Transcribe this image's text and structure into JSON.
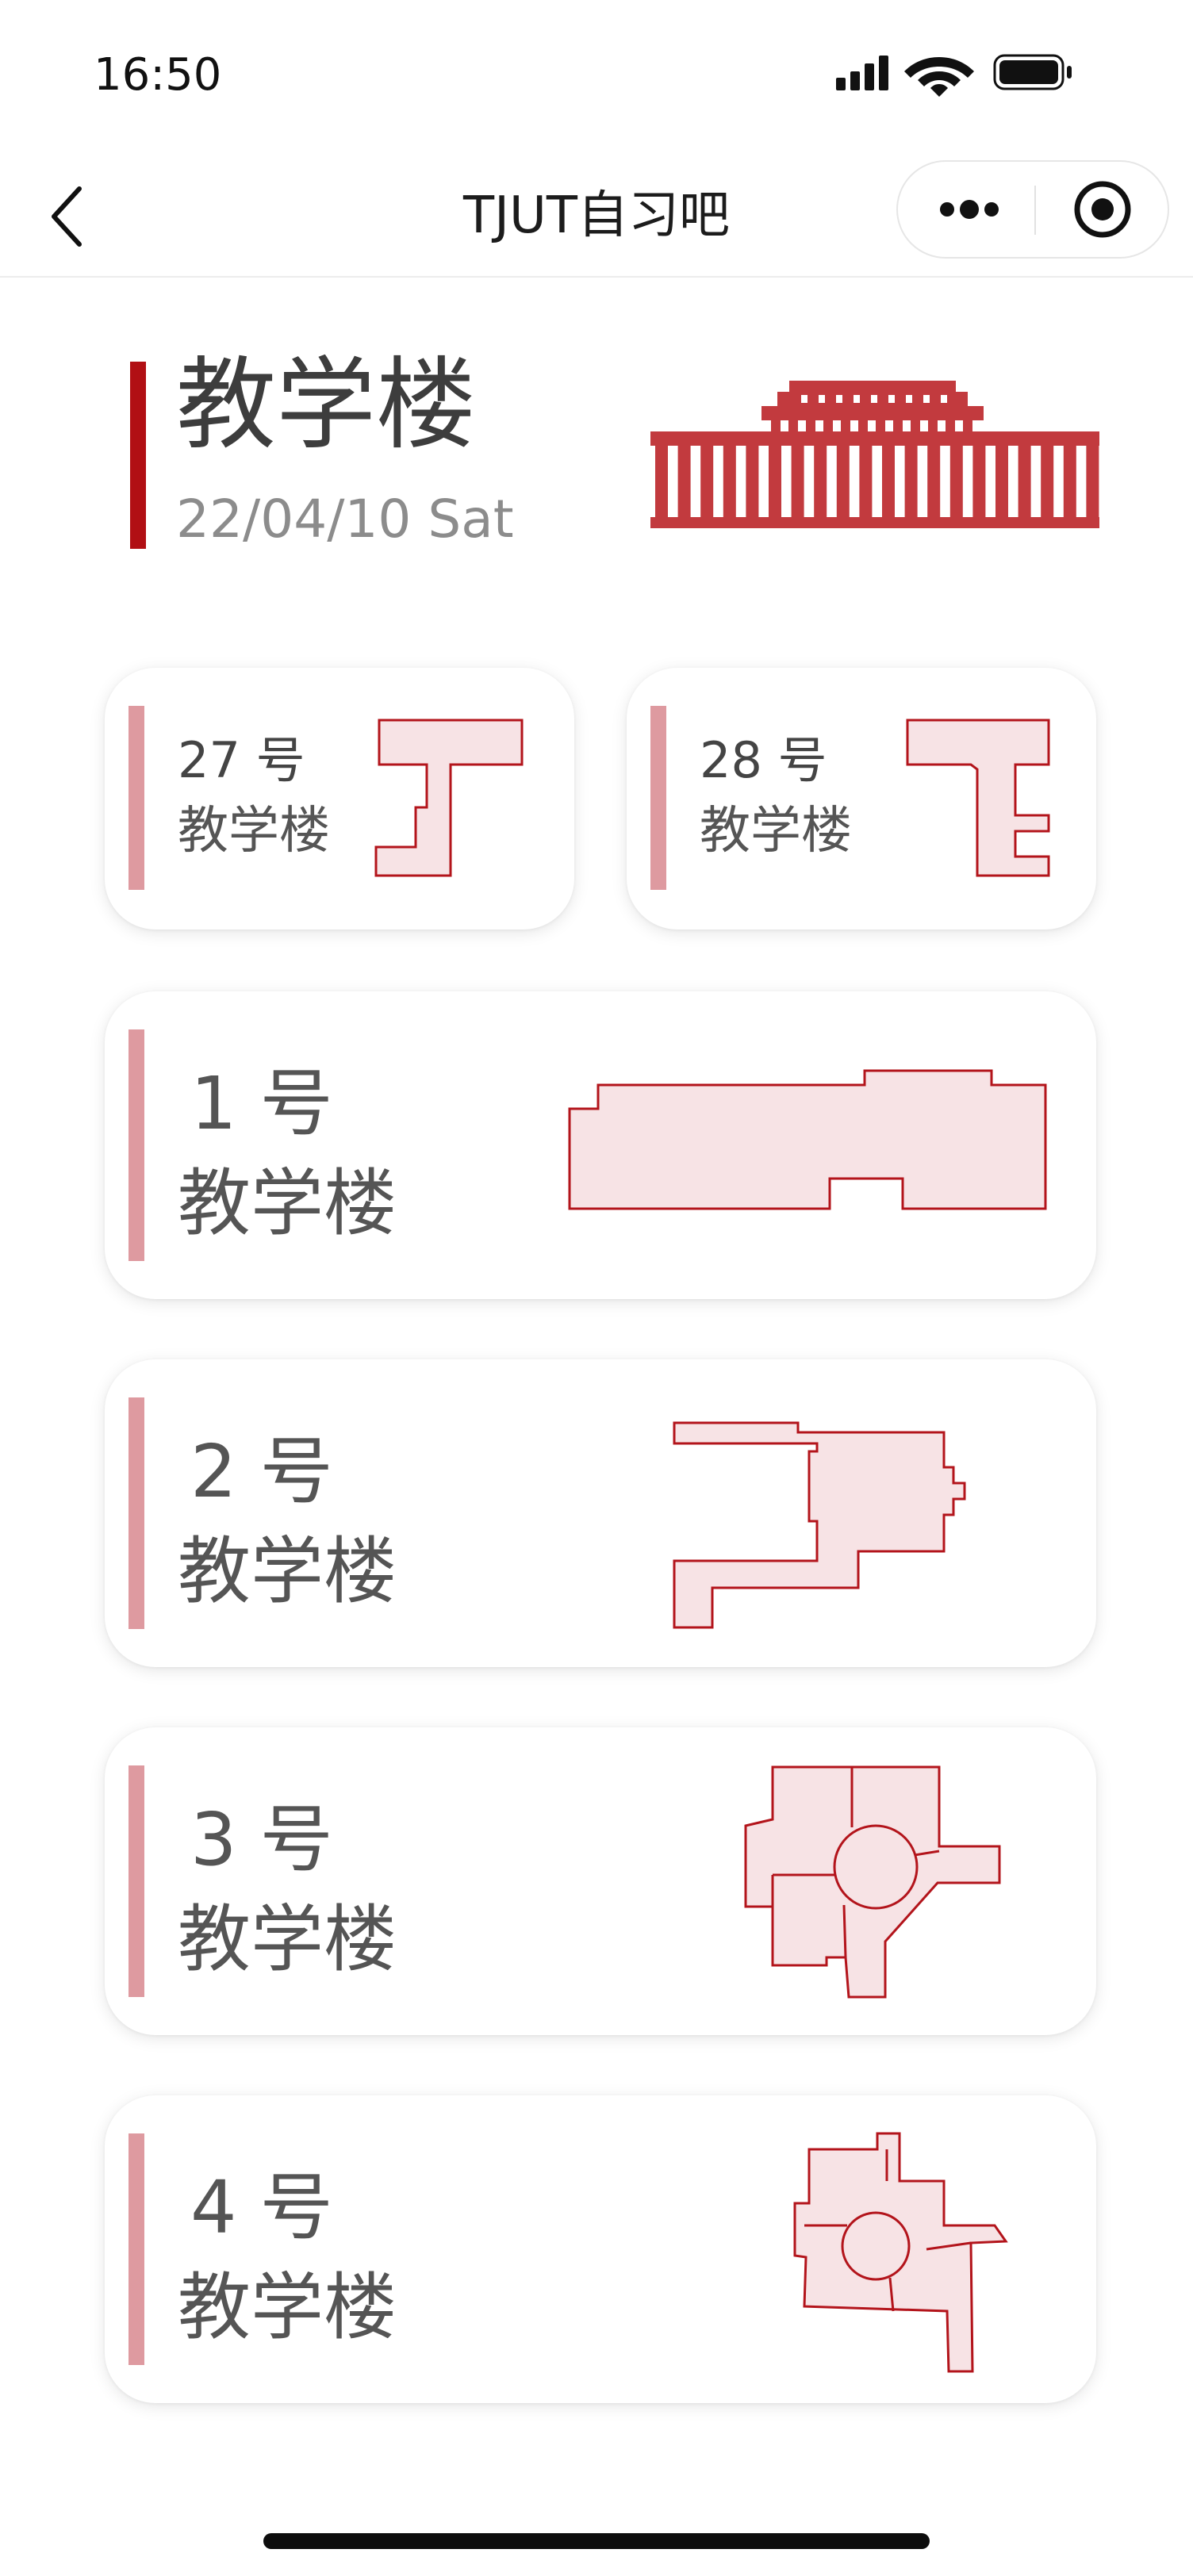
{
  "status_bar": {
    "time": "16:50",
    "icons": [
      "signal-icon",
      "wifi-icon",
      "battery-icon"
    ]
  },
  "nav": {
    "title": "TJUT自习吧",
    "back_icon": "chevron-left-icon",
    "more_icon": "more-dots-icon",
    "close_icon": "target-close-icon"
  },
  "header": {
    "title": "教学楼",
    "date": "22/04/10 Sat",
    "illustration": "building-facade-icon"
  },
  "buildings": [
    {
      "number": "27 号",
      "name": "教学楼"
    },
    {
      "number": "28 号",
      "name": "教学楼"
    },
    {
      "number": "1 号",
      "name": "教学楼"
    },
    {
      "number": "2 号",
      "name": "教学楼"
    },
    {
      "number": "3 号",
      "name": "教学楼"
    },
    {
      "number": "4 号",
      "name": "教学楼"
    }
  ],
  "colors": {
    "accent_red": "#b10f14",
    "card_bar": "#de9aa0",
    "plan_fill": "#f7e3e5",
    "plan_stroke": "#b3141b"
  }
}
